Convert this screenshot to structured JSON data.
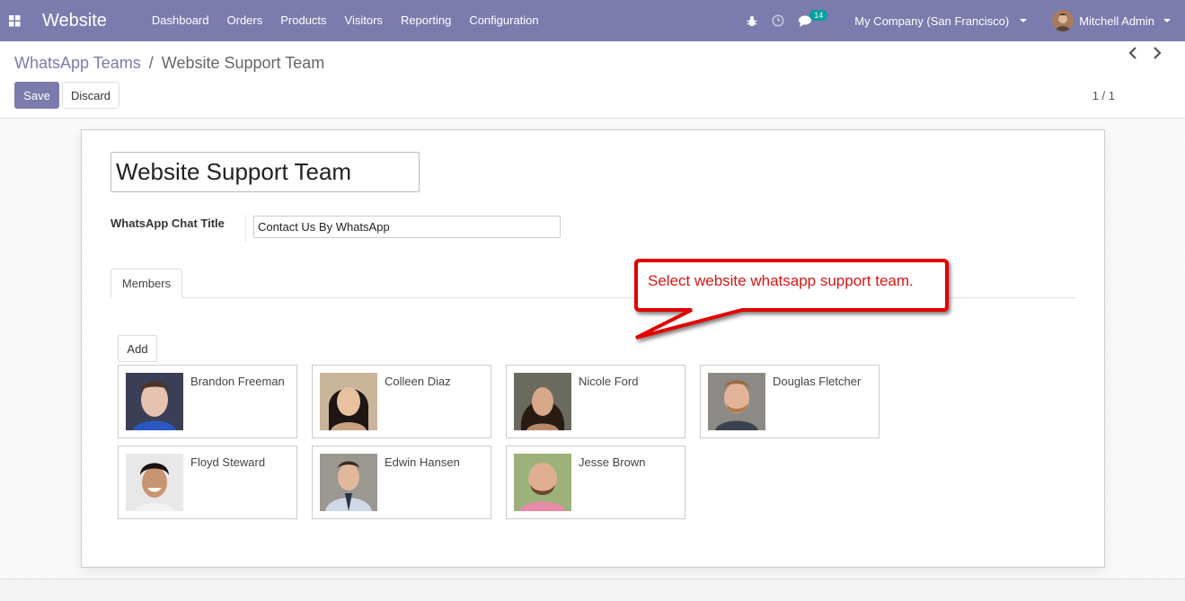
{
  "navbar": {
    "app_name": "Website",
    "menu": [
      "Dashboard",
      "Orders",
      "Products",
      "Visitors",
      "Reporting",
      "Configuration"
    ],
    "chat_badge": "14",
    "company": "My Company (San Francisco)",
    "user": "Mitchell Admin",
    "bar_color": "#7c7bad"
  },
  "control": {
    "breadcrumb_parent": "WhatsApp Teams",
    "breadcrumb_sep": "/",
    "breadcrumb_current": "Website Support Team",
    "save_label": "Save",
    "discard_label": "Discard",
    "pager": "1 / 1"
  },
  "form": {
    "name_value": "Website Support Team",
    "chat_title_label": "WhatsApp Chat Title",
    "chat_title_value": "Contact Us By WhatsApp",
    "tab_members": "Members",
    "add_label": "Add",
    "members": [
      {
        "name": "Brandon Freeman"
      },
      {
        "name": "Colleen Diaz"
      },
      {
        "name": "Nicole Ford"
      },
      {
        "name": "Douglas Fletcher"
      },
      {
        "name": "Floyd Steward"
      },
      {
        "name": "Edwin Hansen"
      },
      {
        "name": "Jesse Brown"
      }
    ]
  },
  "annotation": {
    "text": "Select website whatsapp support  team.",
    "color": "#d81414"
  }
}
